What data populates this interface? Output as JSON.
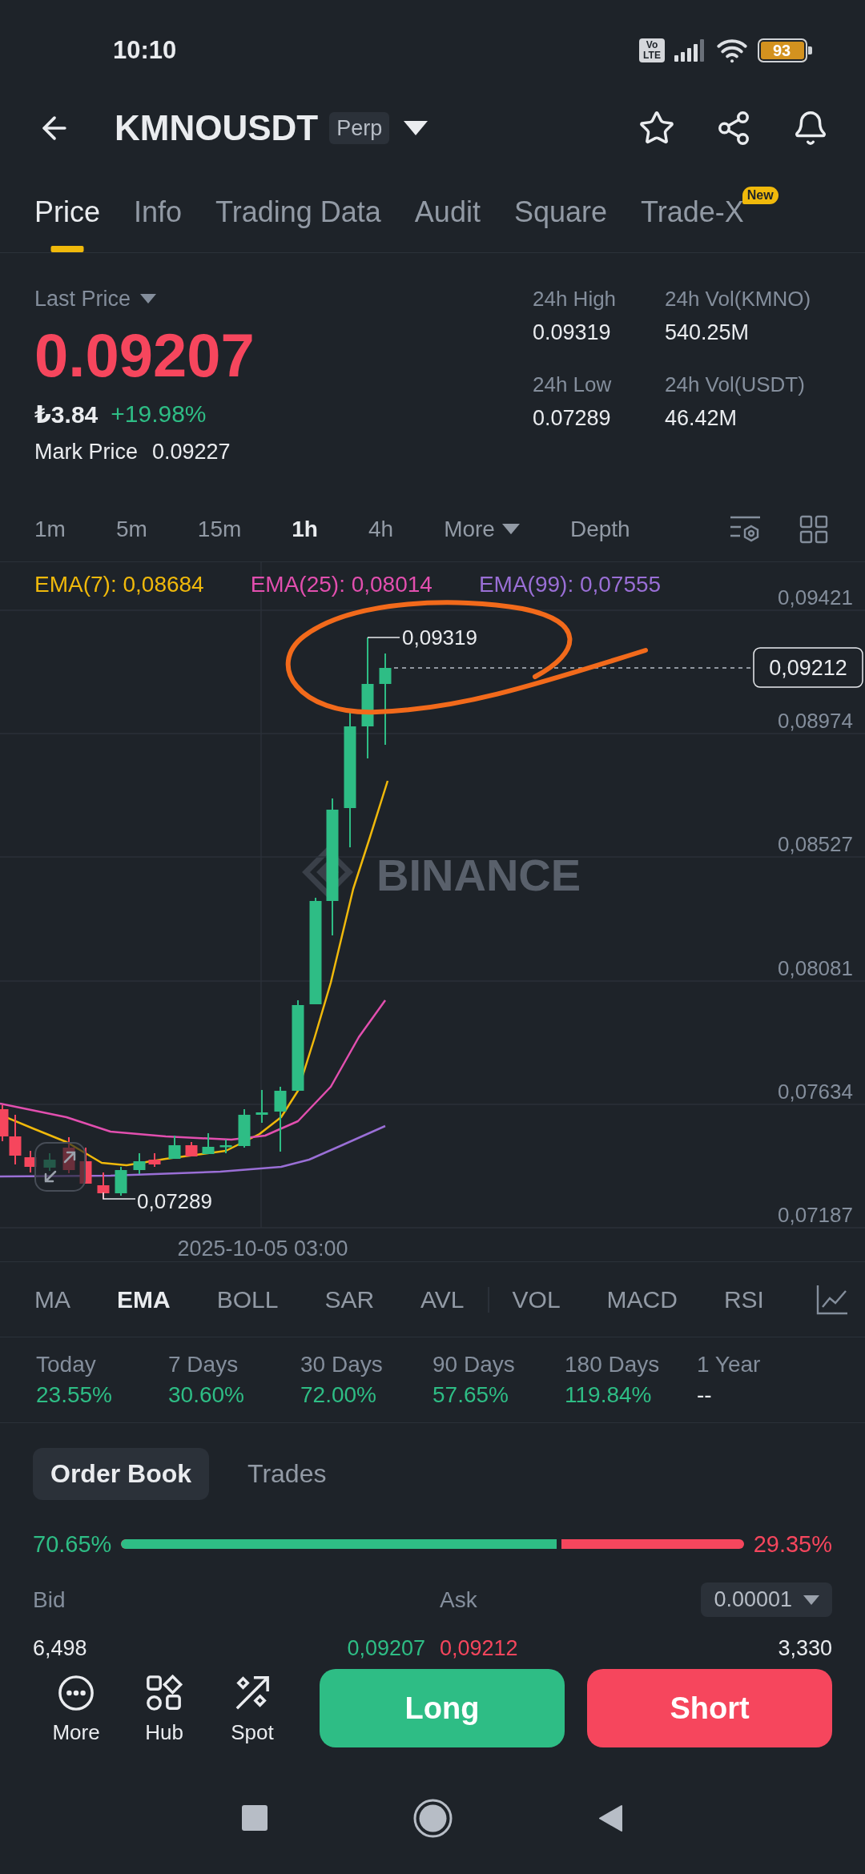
{
  "status_bar": {
    "time": "10:10",
    "network_badge": "Vo LTE",
    "battery": "93"
  },
  "header": {
    "symbol": "KMNOUSDT",
    "contract_badge": "Perp",
    "favorite": false
  },
  "tabs": [
    {
      "label": "Price",
      "selected": true
    },
    {
      "label": "Info",
      "selected": false
    },
    {
      "label": "Trading Data",
      "selected": false
    },
    {
      "label": "Audit",
      "selected": false
    },
    {
      "label": "Square",
      "selected": false
    },
    {
      "label": "Trade-X",
      "selected": false,
      "badge": "New"
    }
  ],
  "ticker": {
    "last_price_label": "Last Price",
    "last_price": "0.09207",
    "price_falling": true,
    "fiat_price": "₺3.84",
    "change": "+19.98%",
    "change_positive": true,
    "mark_price_label": "Mark Price",
    "mark_price": "0.09227"
  },
  "stats": [
    {
      "label": "24h High",
      "value": "0.09319"
    },
    {
      "label": "24h Vol(KMNO)",
      "value": "540.25M"
    },
    {
      "label": "24h Low",
      "value": "0.07289"
    },
    {
      "label": "24h Vol(USDT)",
      "value": "46.42M"
    }
  ],
  "intervals": [
    {
      "label": "1m",
      "kind": "interval",
      "selected": false
    },
    {
      "label": "5m",
      "kind": "interval",
      "selected": false
    },
    {
      "label": "15m",
      "kind": "interval",
      "selected": false
    },
    {
      "label": "1h",
      "kind": "interval",
      "selected": true
    },
    {
      "label": "4h",
      "kind": "interval",
      "selected": false
    },
    {
      "label": "More",
      "kind": "menu",
      "selected": false
    },
    {
      "label": "Depth",
      "kind": "view",
      "selected": false
    }
  ],
  "chart": {
    "legend": [
      {
        "label": "EMA(7): 0,08684",
        "color": "#f0b90b"
      },
      {
        "label": "EMA(25): 0,08014",
        "color": "#e24faf"
      },
      {
        "label": "EMA(99): 0,07555",
        "color": "#9a6fd6"
      }
    ],
    "watermark": "BINANCE",
    "price_axis": [
      "0,09421",
      "0,08974",
      "0,08527",
      "0,08081",
      "0,07634",
      "0,07187"
    ],
    "high_label": "0,09319",
    "low_label": "0,07289",
    "current_price": "0,09212",
    "time_label": "2025-10-05 03:00"
  },
  "indicator_groups": [
    {
      "items": [
        {
          "label": "MA",
          "selected": false
        },
        {
          "label": "EMA",
          "selected": true
        },
        {
          "label": "BOLL",
          "selected": false
        },
        {
          "label": "SAR",
          "selected": false
        },
        {
          "label": "AVL",
          "selected": false
        }
      ]
    },
    {
      "items": [
        {
          "label": "VOL",
          "selected": false
        },
        {
          "label": "MACD",
          "selected": false
        },
        {
          "label": "RSI",
          "selected": false
        }
      ]
    }
  ],
  "performance": [
    {
      "label": "Today",
      "value": "23.55%",
      "kind": "gain"
    },
    {
      "label": "7 Days",
      "value": "30.60%",
      "kind": "gain"
    },
    {
      "label": "30 Days",
      "value": "72.00%",
      "kind": "gain"
    },
    {
      "label": "90 Days",
      "value": "57.65%",
      "kind": "gain"
    },
    {
      "label": "180 Days",
      "value": "119.84%",
      "kind": "gain"
    },
    {
      "label": "1 Year",
      "value": "--",
      "kind": "blank"
    }
  ],
  "order_book": {
    "tabs": [
      {
        "label": "Order Book",
        "selected": true
      },
      {
        "label": "Trades",
        "selected": false
      }
    ],
    "ratio": {
      "bid": "70.65%",
      "ask": "29.35%",
      "level": 0.7065
    },
    "bid_header": "Bid",
    "ask_header": "Ask",
    "precision": "0.00001",
    "rows": [
      {
        "bid_quantity": "6,498",
        "bid_price": "0,09207",
        "ask_price": "0,09212",
        "ask_quantity": "3,330"
      }
    ]
  },
  "shortcuts": [
    {
      "label": "More",
      "kind": "more"
    },
    {
      "label": "Hub",
      "kind": "hub"
    },
    {
      "label": "Spot",
      "kind": "spot"
    }
  ],
  "actions": [
    {
      "label": "Long",
      "kind": "long"
    },
    {
      "label": "Short",
      "kind": "short"
    }
  ]
}
